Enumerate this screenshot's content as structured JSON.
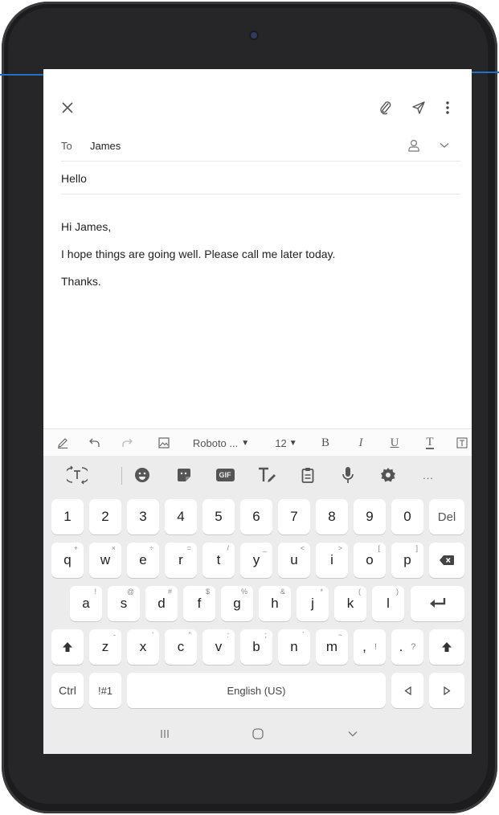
{
  "email": {
    "to_label": "To",
    "to_value": "James",
    "subject": "Hello",
    "body_lines": [
      "Hi James,",
      "I hope things are going well. Please call me later today.",
      "Thanks."
    ]
  },
  "header_icons": [
    "close-icon",
    "attach-icon",
    "send-icon",
    "more-icon"
  ],
  "format_toolbar": {
    "font": "Roboto ...",
    "size": "12",
    "bold": "B",
    "italic": "I",
    "underline": "U",
    "text_color": "T"
  },
  "keyboard": {
    "toolbar_icons": [
      "translate-icon",
      "emoji-icon",
      "sticker-icon",
      "gif-icon",
      "handwriting-icon",
      "clipboard-icon",
      "microphone-icon",
      "settings-icon",
      "more-icon"
    ],
    "gif_label": "GIF",
    "more_label": "...",
    "rows": [
      [
        {
          "k": "1"
        },
        {
          "k": "2"
        },
        {
          "k": "3"
        },
        {
          "k": "4"
        },
        {
          "k": "5"
        },
        {
          "k": "6"
        },
        {
          "k": "7"
        },
        {
          "k": "8"
        },
        {
          "k": "9"
        },
        {
          "k": "0"
        },
        {
          "k": "Del"
        }
      ],
      [
        {
          "k": "q",
          "s": "+"
        },
        {
          "k": "w",
          "s": "×"
        },
        {
          "k": "e",
          "s": "÷"
        },
        {
          "k": "r",
          "s": "="
        },
        {
          "k": "t",
          "s": "/"
        },
        {
          "k": "y",
          "s": "_"
        },
        {
          "k": "u",
          "s": "<"
        },
        {
          "k": "i",
          "s": ">"
        },
        {
          "k": "o",
          "s": "["
        },
        {
          "k": "p",
          "s": "]"
        }
      ],
      [
        {
          "k": "a",
          "s": "!"
        },
        {
          "k": "s",
          "s": "@"
        },
        {
          "k": "d",
          "s": "#"
        },
        {
          "k": "f",
          "s": "$"
        },
        {
          "k": "g",
          "s": "%"
        },
        {
          "k": "h",
          "s": "&"
        },
        {
          "k": "j",
          "s": "*"
        },
        {
          "k": "k",
          "s": "("
        },
        {
          "k": "l",
          "s": ")"
        }
      ],
      [
        {
          "k": "z",
          "s": "-"
        },
        {
          "k": "x",
          "s": "'"
        },
        {
          "k": "c",
          "s": "\""
        },
        {
          "k": "v",
          "s": ":"
        },
        {
          "k": "b",
          "s": ";"
        },
        {
          "k": "n",
          "s": "`"
        },
        {
          "k": "m",
          "s": "~"
        }
      ],
      [
        {
          "k": ",",
          "s": "!"
        },
        {
          "k": ".",
          "s": "?"
        }
      ]
    ],
    "ctrl": "Ctrl",
    "symbols": "!#1",
    "space": "English (US)"
  },
  "colors": {
    "callout": "#1e73c8",
    "keyboard_bg": "#ececec",
    "frame": "#1c1c1e"
  }
}
